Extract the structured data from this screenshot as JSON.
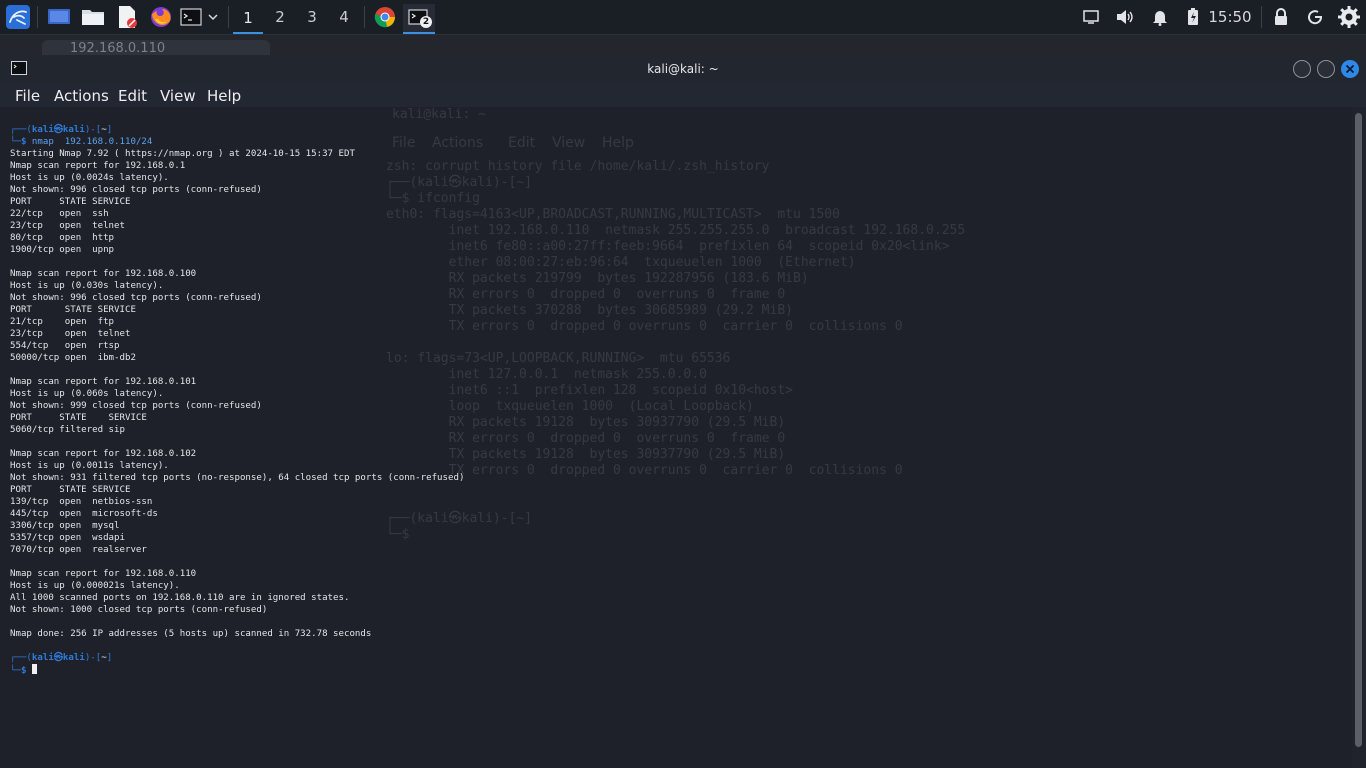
{
  "panel": {
    "workspaces": [
      "1",
      "2",
      "3",
      "4"
    ],
    "active_workspace": "1",
    "terminal_badge": "2",
    "clock": "15:50"
  },
  "ghost_window": {
    "tab_title": "192.168.0.110",
    "terminal_title": "kali@kali: ~",
    "menu": [
      "File",
      "Actions",
      "Edit",
      "View",
      "Help"
    ],
    "lines": [
      "zsh: corrupt history file /home/kali/.zsh_history",
      "┌──(kali㉿kali)-[~]",
      "└─$ ifconfig",
      "eth0: flags=4163<UP,BROADCAST,RUNNING,MULTICAST>  mtu 1500",
      "        inet 192.168.0.110  netmask 255.255.255.0  broadcast 192.168.0.255",
      "        inet6 fe80::a00:27ff:feeb:9664  prefixlen 64  scopeid 0x20<link>",
      "        ether 08:00:27:eb:96:64  txqueuelen 1000  (Ethernet)",
      "        RX packets 219799  bytes 192287956 (183.6 MiB)",
      "        RX errors 0  dropped 0  overruns 0  frame 0",
      "        TX packets 370288  bytes 30685989 (29.2 MiB)",
      "        TX errors 0  dropped 0 overruns 0  carrier 0  collisions 0",
      "lo: flags=73<UP,LOOPBACK,RUNNING>  mtu 65536",
      "        inet 127.0.0.1  netmask 255.0.0.0",
      "        inet6 ::1  prefixlen 128  scopeid 0x10<host>",
      "        loop  txqueuelen 1000  (Local Loopback)",
      "        RX packets 19128  bytes 30937790 (29.5 MiB)",
      "        RX errors 0  dropped 0  overruns 0  frame 0",
      "        TX packets 19128  bytes 30937790 (29.5 MiB)",
      "        TX errors 0  dropped 0 overruns 0  carrier 0  collisions 0",
      "┌──(kali㉿kali)-[~]",
      "└─$ "
    ]
  },
  "window": {
    "title": "kali@kali: ~",
    "menu": {
      "file": "File",
      "actions": "Actions",
      "edit": "Edit",
      "view": "View",
      "help": "Help"
    }
  },
  "prompt": {
    "box_top": "┌──(",
    "user": "kali",
    "skull": "㉿",
    "host": "kali",
    "dir_open": ")-[",
    "dir": "~",
    "dir_close": "]",
    "box_bottom": "└─",
    "dollar": "$"
  },
  "command": "nmap  192.168.0.110/24",
  "output": "Starting Nmap 7.92 ( https://nmap.org ) at 2024-10-15 15:37 EDT\nNmap scan report for 192.168.0.1\nHost is up (0.0024s latency).\nNot shown: 996 closed tcp ports (conn-refused)\nPORT     STATE SERVICE\n22/tcp   open  ssh\n23/tcp   open  telnet\n80/tcp   open  http\n1900/tcp open  upnp\n\nNmap scan report for 192.168.0.100\nHost is up (0.030s latency).\nNot shown: 996 closed tcp ports (conn-refused)\nPORT      STATE SERVICE\n21/tcp    open  ftp\n23/tcp    open  telnet\n554/tcp   open  rtsp\n50000/tcp open  ibm-db2\n\nNmap scan report for 192.168.0.101\nHost is up (0.060s latency).\nNot shown: 999 closed tcp ports (conn-refused)\nPORT     STATE    SERVICE\n5060/tcp filtered sip\n\nNmap scan report for 192.168.0.102\nHost is up (0.0011s latency).\nNot shown: 931 filtered tcp ports (no-response), 64 closed tcp ports (conn-refused)\nPORT     STATE SERVICE\n139/tcp  open  netbios-ssn\n445/tcp  open  microsoft-ds\n3306/tcp open  mysql\n5357/tcp open  wsdapi\n7070/tcp open  realserver\n\nNmap scan report for 192.168.0.110\nHost is up (0.000021s latency).\nAll 1000 scanned ports on 192.168.0.110 are in ignored states.\nNot shown: 1000 closed tcp ports (conn-refused)\n\nNmap done: 256 IP addresses (5 hosts up) scanned in 732.78 seconds\n",
  "colors": {
    "prompt_blue": "#2e7bd8",
    "panel_bg": "#1a1e25",
    "terminal_bg": "#1e212a",
    "close_button": "#2e88e8"
  },
  "icons": [
    "kali-menu-icon",
    "show-desktop-icon",
    "file-manager-icon",
    "text-editor-icon",
    "firefox-icon",
    "terminal-icon",
    "chromium-icon",
    "display-icon",
    "volume-icon",
    "notifications-icon",
    "battery-icon",
    "lock-icon",
    "power-icon",
    "settings-icon"
  ]
}
